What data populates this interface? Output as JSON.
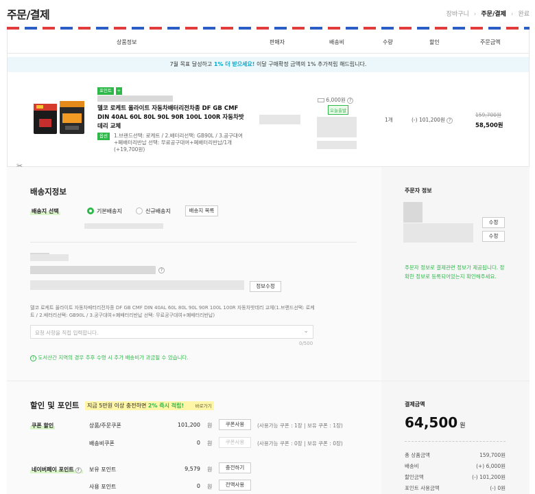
{
  "page": {
    "title": "주문/결제"
  },
  "steps": [
    "장바구니",
    "주문/결제",
    "완료"
  ],
  "table_headers": {
    "product": "상품정보",
    "seller": "판매자",
    "shipping": "배송비",
    "qty": "수량",
    "discount": "할인",
    "amount": "주문금액"
  },
  "promo": {
    "pre": "7월 목표 달성하고 ",
    "highlight": "1% 더 받으세요!",
    "post": " 이달 구매확정 금액의 1% 추가적립 해드립니다."
  },
  "product": {
    "badge": "포인트",
    "name": "델코 로케트 올라이트 자동차배터리전차종 DF GB CMF DIN 40AL 60L 80L 90L 90R 100L 100R 자동차밧데리 교체",
    "option_badge": "옵션",
    "option_text": "1.브랜드선택: 로케트 / 2.배터리선택: GB90L / 3.공구대여+폐배터리반납 선택: 무료공구대여+폐배터리반납/1개 (+19,700원)",
    "shipping_fee": "6,000원",
    "shipping_badge": "오늘출발",
    "qty": "1개",
    "discount": "(-) 101,200원",
    "orig_price": "159,700원",
    "final_price": "58,500원"
  },
  "shipping": {
    "heading": "배송지정보",
    "select_label": "배송지 선택",
    "radio_default": "기본배송지",
    "radio_new": "신규배송지",
    "list_button": "배송지 목록",
    "edit_button": "정보수정",
    "summary": "델코 로케트 올라이트 자동차배터리전차종 DF GB CMF DIN 40AL 60L 80L 90L 90R 100L 100R 자동차밧데리 교체(1.브랜드선택: 로케트 / 2.배터리선택: GB90L / 3.공구대여+폐배터리반납 선택: 무료공구대여+폐배터리반납)",
    "request_placeholder": "요청 사항을 직접 입력합니다.",
    "char_count": "0/500",
    "notice": "도서산간 지역의 경우 추후 수령 시 추가 배송비가 과금될 수 있습니다."
  },
  "orderer": {
    "heading": "주문자 정보",
    "edit1": "수정",
    "edit2": "수정",
    "note": "주문자 정보로 결제관련 정보가 제공됩니다. 정확한 정보로 등록되어있는지 확인해주세요."
  },
  "discount_section": {
    "heading": "할인 및 포인트",
    "promo_pre": "지금 5만원 이상 충전하면 ",
    "promo_highlight": "2% 즉시 적립!",
    "promo_link": "바로가기",
    "coupon_label": "쿠폰 할인",
    "product_coupon": "상품/주문쿠폰",
    "product_coupon_value": "101,200",
    "won": "원",
    "coupon_button": "쿠폰사용",
    "product_coupon_info": "(사용가능 쿠폰 : 1장 | 보유 쿠폰 : 1장)",
    "ship_coupon": "배송비쿠폰",
    "ship_coupon_value": "0",
    "ship_coupon_info": "(사용가능 쿠폰 : 0장 | 보유 쿠폰 : 0장)",
    "point_label": "네이버페이 포인트",
    "owned_points": "보유 포인트",
    "owned_points_value": "9,579",
    "charge_button": "충전하기",
    "use_points": "사용 포인트",
    "use_points_value": "0",
    "use_all_button": "전액사용"
  },
  "payment": {
    "heading": "결제금액",
    "total": "64,500",
    "won": "원",
    "rows": [
      {
        "label": "총 상품금액",
        "value": "159,700원"
      },
      {
        "label": "배송비",
        "value": "(+) 6,000원"
      },
      {
        "label": "할인금액",
        "value": "(-) 101,200원"
      },
      {
        "label": "포인트 사용금액",
        "value": "(-) 0원"
      }
    ]
  },
  "colors": {
    "accent_green": "#2fb84a",
    "promo_blue": "#00aacc",
    "airmail_red": "#e23b3b",
    "airmail_blue": "#2b5dc6"
  }
}
